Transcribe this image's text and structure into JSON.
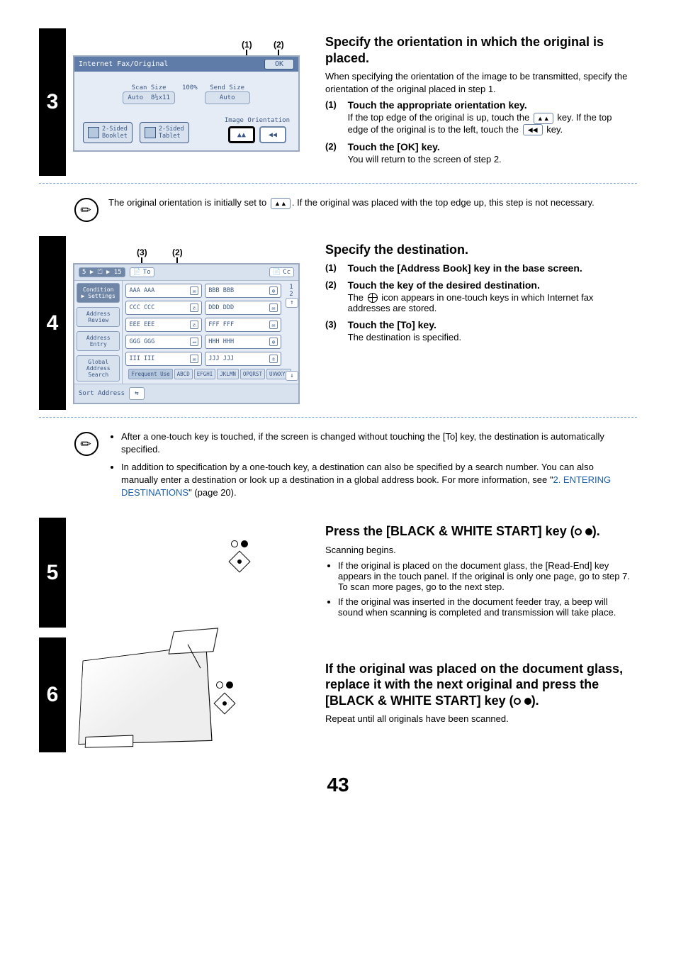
{
  "page_number": "43",
  "step3": {
    "num": "3",
    "callouts": {
      "c1": "(1)",
      "c2": "(2)"
    },
    "panel": {
      "title": "Internet Fax/Original",
      "ok": "OK",
      "scan_size_lbl": "Scan Size",
      "percent": "100%",
      "send_size_lbl": "Send Size",
      "scan_auto": "Auto",
      "scan_dim": "8½x11",
      "send_auto": "Auto",
      "two_sided_booklet": "2-Sided\nBooklet",
      "two_sided_tablet": "2-Sided\nTablet",
      "orient_label": "Image Orientation",
      "orient_a": "▲▲",
      "orient_b": "◀◀"
    },
    "title": "Specify the orientation in which the original is placed.",
    "intro": "When specifying the orientation of the image to be transmitted, specify the orientation of the original placed in step 1.",
    "s1_head": "Touch the appropriate orientation key.",
    "s1_body_a": "If the top edge of the original is up, touch the ",
    "s1_body_b": " key. If the top edge of the original is to the left, touch the ",
    "s1_body_c": " key.",
    "s2_head": "Touch the [OK] key.",
    "s2_body": "You will return to the screen of step 2.",
    "note_a": "The original orientation is initially set to ",
    "note_b": ". If the original was placed with the top edge up, this step is not necessary."
  },
  "step4": {
    "num": "4",
    "callouts": {
      "c2": "(2)",
      "c3": "(3)"
    },
    "ab": {
      "counter": "5 ▶ ⏍ ▶ 15",
      "to": "To",
      "cc": "Cc",
      "cond1": "Condition",
      "cond2": "Settings",
      "addr_review": "Address Review",
      "addr_entry": "Address Entry",
      "global1": "Global",
      "global2": "Address Search",
      "sort": "Sort Address",
      "rows": [
        [
          "AAA AAA",
          "BBB BBB"
        ],
        [
          "CCC CCC",
          "DDD DDD"
        ],
        [
          "EEE EEE",
          "FFF FFF"
        ],
        [
          "GGG GGG",
          "HHH HHH"
        ],
        [
          "III III",
          "JJJ JJJ"
        ]
      ],
      "page_top": "1",
      "page_bot": "2",
      "tabs": [
        "Frequent Use",
        "ABCD",
        "EFGHI",
        "JKLMN",
        "OPQRST",
        "UVWXYZ"
      ]
    },
    "title": "Specify the destination.",
    "s1_head": "Touch the [Address Book] key in the base screen.",
    "s2_head": "Touch the key of the desired destination.",
    "s2_body_a": "The ",
    "s2_body_b": " icon appears in one-touch keys in which Internet fax addresses are stored.",
    "s3_head": "Touch the [To] key.",
    "s3_body": "The destination is specified.",
    "note_b1": "After a one-touch key is touched, if the screen is changed without touching the [To] key, the destination is automatically specified.",
    "note_b2_a": "In addition to specification by a one-touch key, a destination can also be specified by a search number. You can also manually enter a destination or look up a destination in a global address book. For more information, see \"",
    "note_b2_link": "2. ENTERING DESTINATIONS",
    "note_b2_b": "\" (page 20)."
  },
  "step5": {
    "num": "5",
    "title_a": "Press the [BLACK & WHITE START] key (",
    "title_b": ").",
    "p1": "Scanning begins.",
    "b1": "If the original is placed on the document glass, the [Read-End] key appears in the touch panel. If the original is only one page, go to step 7. To scan more pages, go to the next step.",
    "b2": "If the original was inserted in the document feeder tray, a beep will sound when scanning is completed and transmission will take place."
  },
  "step6": {
    "num": "6",
    "title_a": "If the original was placed on the document glass, replace it with the next original and press the [BLACK & WHITE START] key (",
    "title_b": ").",
    "p1": "Repeat until all originals have been scanned."
  }
}
